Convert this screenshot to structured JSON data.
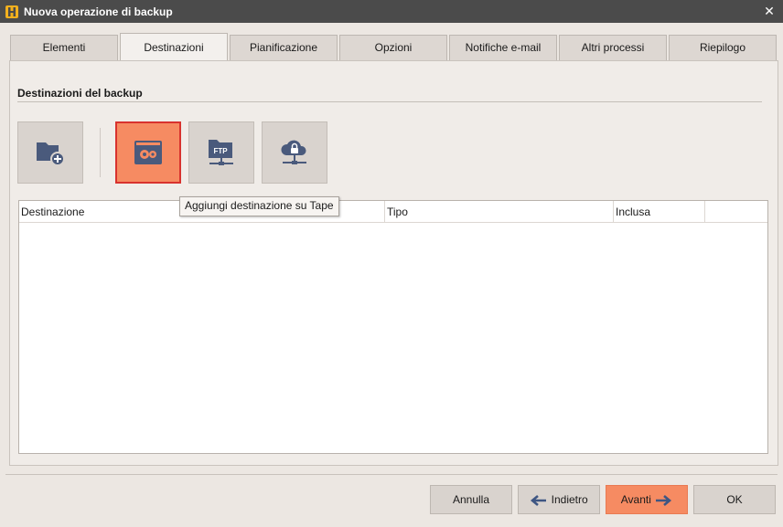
{
  "window": {
    "title": "Nuova operazione di backup",
    "close_glyph": "✕"
  },
  "tabs": [
    {
      "label": "Elementi"
    },
    {
      "label": "Destinazioni",
      "active": true
    },
    {
      "label": "Pianificazione"
    },
    {
      "label": "Opzioni"
    },
    {
      "label": "Notifiche e-mail"
    },
    {
      "label": "Altri processi"
    },
    {
      "label": "Riepilogo"
    }
  ],
  "section": {
    "title": "Destinazioni del backup"
  },
  "toolbar": {
    "buttons": [
      {
        "icon": "folder-add-icon"
      },
      {
        "icon": "tape-icon",
        "active": true
      },
      {
        "icon": "ftp-folder-icon"
      },
      {
        "icon": "cloud-lock-icon"
      }
    ],
    "tooltip": "Aggiungi destinazione su Tape"
  },
  "table": {
    "columns": [
      "Destinazione",
      "Tipo",
      "Inclusa"
    ],
    "rows": []
  },
  "footer": {
    "cancel_label": "Annulla",
    "back_label": "Indietro",
    "next_label": "Avanti",
    "ok_label": "OK"
  },
  "colors": {
    "accent": "#f68b62",
    "active_border": "#d8322e",
    "icon": "#4a5a7c",
    "titlebar": "#4b4b4b"
  }
}
